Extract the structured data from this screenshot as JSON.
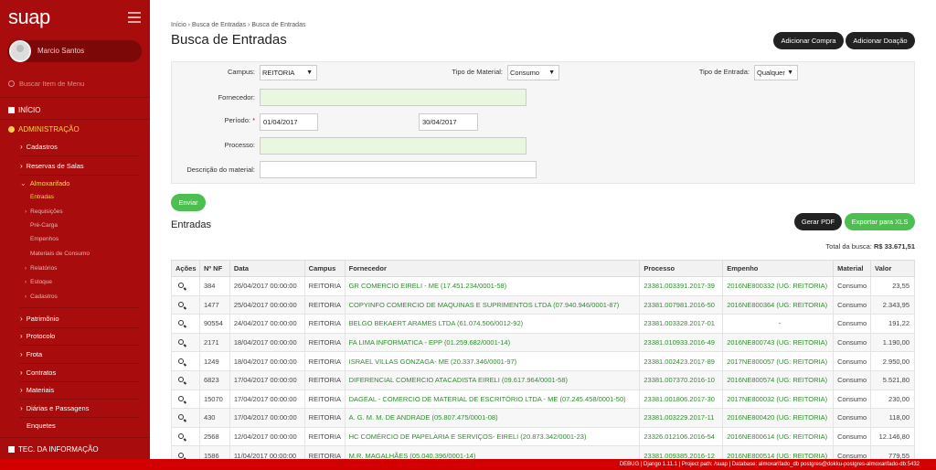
{
  "app": {
    "logo": "suap",
    "user_name": "Marcio Santos",
    "search_placeholder": "Buscar Item de Menu"
  },
  "menu": {
    "inicio": "INÍCIO",
    "administracao": "ADMINISTRAÇÃO",
    "cadastros": "Cadastros",
    "reservas": "Reservas de Salas",
    "almoxarifado": "Almoxarifado",
    "almox_items": [
      "Entradas",
      "Requisições",
      "Pré-Carga",
      "Empenhos",
      "Materiais de Consumo",
      "Relatórios",
      "Estoque",
      "Cadastros"
    ],
    "patrimonio": "Patrimônio",
    "protocolo": "Protocolo",
    "frota": "Frota",
    "contratos": "Contratos",
    "materiais": "Materiais",
    "diarias": "Diárias e Passagens",
    "enquetes": "Enquetes",
    "tec": "TEC. DA INFORMAÇÃO"
  },
  "breadcrumb": "Início › Busca de Entradas › Busca de Entradas",
  "page_title": "Busca de Entradas",
  "actions": {
    "add_compra": "Adicionar Compra",
    "add_doacao": "Adicionar Doação"
  },
  "form": {
    "campus_label": "Campus:",
    "campus_value": "REITORIA",
    "tipo_material_label": "Tipo de Material:",
    "tipo_material_value": "Consumo",
    "tipo_entrada_label": "Tipo de Entrada:",
    "tipo_entrada_value": "Qualquer",
    "fornecedor_label": "Fornecedor:",
    "periodo_label": "Período:",
    "periodo_req": "*",
    "periodo_inicio": "01/04/2017",
    "periodo_fim": "30/04/2017",
    "processo_label": "Processo:",
    "descricao_label": "Descrição do material:",
    "submit": "Enviar"
  },
  "entradas": {
    "title": "Entradas",
    "gerar_pdf": "Gerar PDF",
    "exportar_xls": "Exportar para XLS",
    "total_label": "Total da busca:",
    "total_value": "R$ 33.671,51",
    "columns": [
      "Ações",
      "Nº NF",
      "Data",
      "Campus",
      "Fornecedor",
      "Processo",
      "Empenho",
      "Material",
      "Valor"
    ],
    "rows": [
      [
        "384",
        "26/04/2017 00:00:00",
        "REITORIA",
        "GR COMERCIO EIRELI - ME (17.451.234/0001-58)",
        "23381.003391.2017-39",
        "2016NE800332 (UG: REITORIA)",
        "Consumo",
        "23,55"
      ],
      [
        "1477",
        "25/04/2017 00:00:00",
        "REITORIA",
        "COPYINFO COMERCIO DE MAQUINAS E SUPRIMENTOS LTDA (07.940.946/0001-87)",
        "23381.007981.2016-50",
        "2016NE800364 (UG: REITORIA)",
        "Consumo",
        "2.343,95"
      ],
      [
        "90554",
        "24/04/2017 00:00:00",
        "REITORIA",
        "BELGO BEKAERT ARAMES LTDA (61.074.506/0012-92)",
        "23381.003328.2017-01",
        "-",
        "Consumo",
        "191,22"
      ],
      [
        "2171",
        "18/04/2017 00:00:00",
        "REITORIA",
        "FA LIMA INFORMATICA - EPP (01.259.682/0001-14)",
        "23381.010933.2016-49",
        "2016NE800743 (UG: REITORIA)",
        "Consumo",
        "1.190,00"
      ],
      [
        "1249",
        "18/04/2017 00:00:00",
        "REITORIA",
        "ISRAEL VILLAS GONZAGA- ME (20.337.346/0001-97)",
        "23381.002423.2017-89",
        "2017NE800057 (UG: REITORIA)",
        "Consumo",
        "2.950,00"
      ],
      [
        "6823",
        "17/04/2017 00:00:00",
        "REITORIA",
        "DIFERENCIAL COMERCIO ATACADISTA EIRELI (09.617.964/0001-58)",
        "23381.007370.2016-10",
        "2016NE800574 (UG: REITORIA)",
        "Consumo",
        "5.521,80"
      ],
      [
        "15070",
        "17/04/2017 00:00:00",
        "REITORIA",
        "DAGEAL - COMERCIO DE MATERIAL DE ESCRITÓRIO LTDA - ME (07.245.458/0001-50)",
        "23381.001806.2017-30",
        "2017NE800032 (UG: REITORIA)",
        "Consumo",
        "230,00"
      ],
      [
        "430",
        "17/04/2017 00:00:00",
        "REITORIA",
        "A. G. M. M. DE ANDRADE (05.807.475/0001-08)",
        "23381.003229.2017-11",
        "2016NE800420 (UG: REITORIA)",
        "Consumo",
        "118,00"
      ],
      [
        "2568",
        "12/04/2017 00:00:00",
        "REITORIA",
        "HC COMÉRCIO DE PAPELARIA E SERVIÇOS- EIRELI (20.873.342/0001-23)",
        "23326.012106.2016-54",
        "2016NE800614 (UG: REITORIA)",
        "Consumo",
        "12.146,80"
      ],
      [
        "1586",
        "11/04/2017 00:00:00",
        "REITORIA",
        "M.R. MAGALHÃES (05.040.396/0001-14)",
        "23381.009385.2016-12",
        "2016NE800514 (UG: REITORIA)",
        "Consumo",
        "779,55"
      ]
    ]
  },
  "debug_bar": "DEBUG | Django 1.11.1 | Project path: /suap | Database: almoxarifado_db postgres@dokku-postgres-almoxarifado-db:5432"
}
